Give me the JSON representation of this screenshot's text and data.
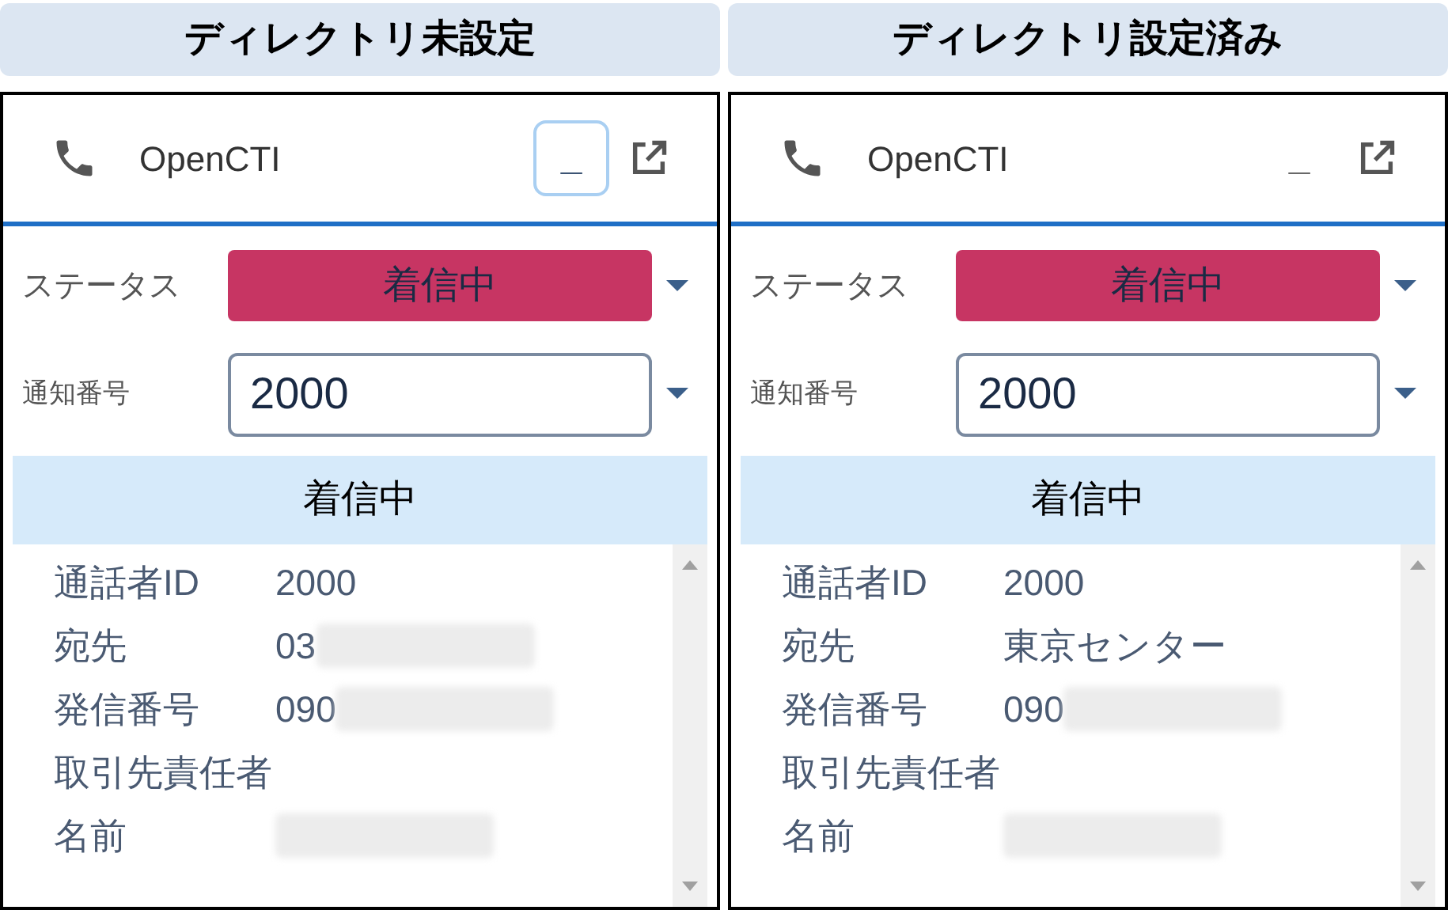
{
  "panels": [
    {
      "heading": "ディレクトリ未設定",
      "title": "OpenCTI",
      "minimize": {
        "label": "_",
        "focused": true
      },
      "status": {
        "label": "ステータス",
        "value": "着信中"
      },
      "number": {
        "label": "通知番号",
        "value": "2000"
      },
      "banner": "着信中",
      "rows": [
        {
          "label": "通話者ID",
          "value": "2000",
          "redacted": false
        },
        {
          "label": "宛先",
          "value": "03",
          "redacted": true
        },
        {
          "label": "発信番号",
          "value": "090",
          "redacted": true
        },
        {
          "label": "取引先責任者",
          "redacted": false
        },
        {
          "label": "名前",
          "redacted": true
        }
      ]
    },
    {
      "heading": "ディレクトリ設定済み",
      "title": "OpenCTI",
      "minimize": {
        "label": "_",
        "focused": false
      },
      "status": {
        "label": "ステータス",
        "value": "着信中"
      },
      "number": {
        "label": "通知番号",
        "value": "2000"
      },
      "banner": "着信中",
      "rows": [
        {
          "label": "通話者ID",
          "value": "2000",
          "redacted": false
        },
        {
          "label": "宛先",
          "value": "東京センター",
          "redacted": false
        },
        {
          "label": "発信番号",
          "value": "090",
          "redacted": true
        },
        {
          "label": "取引先責任者",
          "redacted": false
        },
        {
          "label": "名前",
          "redacted": true
        }
      ]
    }
  ]
}
